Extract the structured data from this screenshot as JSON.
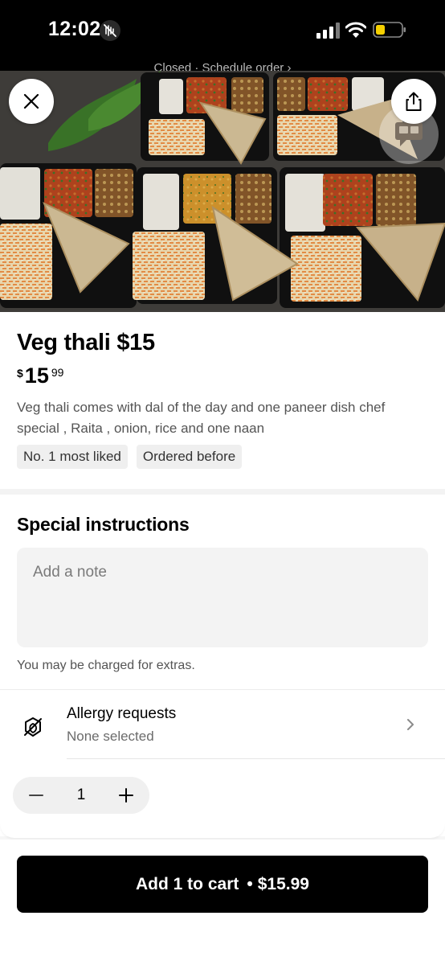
{
  "status_bar": {
    "time": "12:02"
  },
  "banner": {
    "text": "Closed · Schedule order  ›"
  },
  "item": {
    "title": "Veg thali $15",
    "price_currency": "$",
    "price_dollars": "15",
    "price_cents": "99",
    "description": "Veg thali comes with dal of the day and one paneer dish chef special , Raita , onion, rice and one naan",
    "badges": [
      "No. 1 most liked",
      "Ordered before"
    ]
  },
  "special_instructions": {
    "heading": "Special instructions",
    "placeholder": "Add a note",
    "extras_note": "You may be charged for extras."
  },
  "allergy": {
    "title": "Allergy requests",
    "subtitle": "None selected"
  },
  "quantity": {
    "value": "1"
  },
  "cart_button": {
    "label": "Add 1 to cart",
    "separator": "•",
    "price": "$15.99"
  },
  "icons": {
    "close": "close-icon",
    "share": "share-icon",
    "feedback": "feedback-icon",
    "allergy": "allergy-icon",
    "chevron": "chevron-right-icon",
    "minus": "minus-icon",
    "plus": "plus-icon"
  }
}
